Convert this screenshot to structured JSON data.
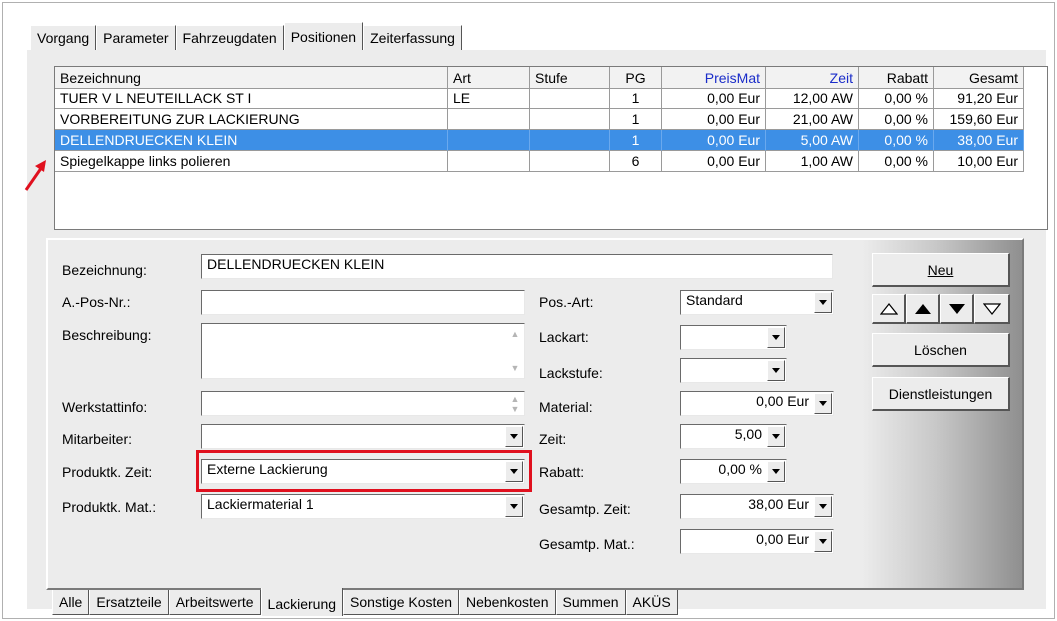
{
  "top_tabs": [
    {
      "label": "Vorgang"
    },
    {
      "label": "Parameter"
    },
    {
      "label": "Fahrzeugdaten"
    },
    {
      "label": "Positionen",
      "active": true
    },
    {
      "label": "Zeiterfassung"
    }
  ],
  "grid": {
    "headers": [
      "Bezeichnung",
      "Art",
      "Stufe",
      "PG",
      "PreisMat",
      "Zeit",
      "Rabatt",
      "Gesamt"
    ],
    "rows": [
      {
        "bez": "TUER V L NEUTEILLACK   ST I",
        "art": "LE",
        "stufe": "",
        "pg": "1",
        "preis": "0,00 Eur",
        "zeit": "12,00 AW",
        "rabatt": "0,00 %",
        "gesamt": "91,20 Eur"
      },
      {
        "bez": "VORBEREITUNG ZUR LACKIERUNG",
        "art": "",
        "stufe": "",
        "pg": "1",
        "preis": "0,00 Eur",
        "zeit": "21,00 AW",
        "rabatt": "0,00 %",
        "gesamt": "159,60 Eur"
      },
      {
        "bez": "DELLENDRUECKEN KLEIN",
        "art": "",
        "stufe": "",
        "pg": "1",
        "preis": "0,00 Eur",
        "zeit": "5,00 AW",
        "rabatt": "0,00 %",
        "gesamt": "38,00 Eur",
        "selected": true
      },
      {
        "bez": "Spiegelkappe links polieren",
        "art": "",
        "stufe": "",
        "pg": "6",
        "preis": "0,00 Eur",
        "zeit": "1,00 AW",
        "rabatt": "0,00 %",
        "gesamt": "10,00 Eur"
      }
    ]
  },
  "form": {
    "bezeichnung_label": "Bezeichnung:",
    "bezeichnung_value": "DELLENDRUECKEN KLEIN",
    "apos_label": "A.-Pos-Nr.:",
    "apos_value": "",
    "beschreibung_label": "Beschreibung:",
    "werkstattinfo_label": "Werkstattinfo:",
    "mitarbeiter_label": "Mitarbeiter:",
    "mitarbeiter_value": "",
    "produktk_zeit_label": "Produktk. Zeit:",
    "produktk_zeit_value": "Externe Lackierung",
    "produktk_mat_label": "Produktk. Mat.:",
    "produktk_mat_value": "Lackiermaterial 1",
    "posart_label": "Pos.-Art:",
    "posart_value": "Standard",
    "lackart_label": "Lackart:",
    "lackart_value": "",
    "lackstufe_label": "Lackstufe:",
    "lackstufe_value": "",
    "material_label": "Material:",
    "material_value": "0,00 Eur",
    "zeit_label": "Zeit:",
    "zeit_value": "5,00",
    "rabatt_label": "Rabatt:",
    "rabatt_value": "0,00 %",
    "gesamtp_zeit_label": "Gesamtp. Zeit:",
    "gesamtp_zeit_value": "38,00 Eur",
    "gesamtp_mat_label": "Gesamtp. Mat.:",
    "gesamtp_mat_value": "0,00 Eur"
  },
  "buttons": {
    "neu": "Neu",
    "loeschen": "Löschen",
    "dienstleistungen": "Dienstleistungen"
  },
  "bottom_tabs": [
    {
      "label": "Alle"
    },
    {
      "label": "Ersatzteile"
    },
    {
      "label": "Arbeitswerte"
    },
    {
      "label": "Lackierung",
      "active": true
    },
    {
      "label": "Sonstige Kosten"
    },
    {
      "label": "Nebenkosten"
    },
    {
      "label": "Summen"
    },
    {
      "label": "AKÜS"
    }
  ],
  "colors": {
    "selection": "#3d8fe6",
    "annotation_red": "#e0101e",
    "header_blue": "#1a2cc9"
  }
}
